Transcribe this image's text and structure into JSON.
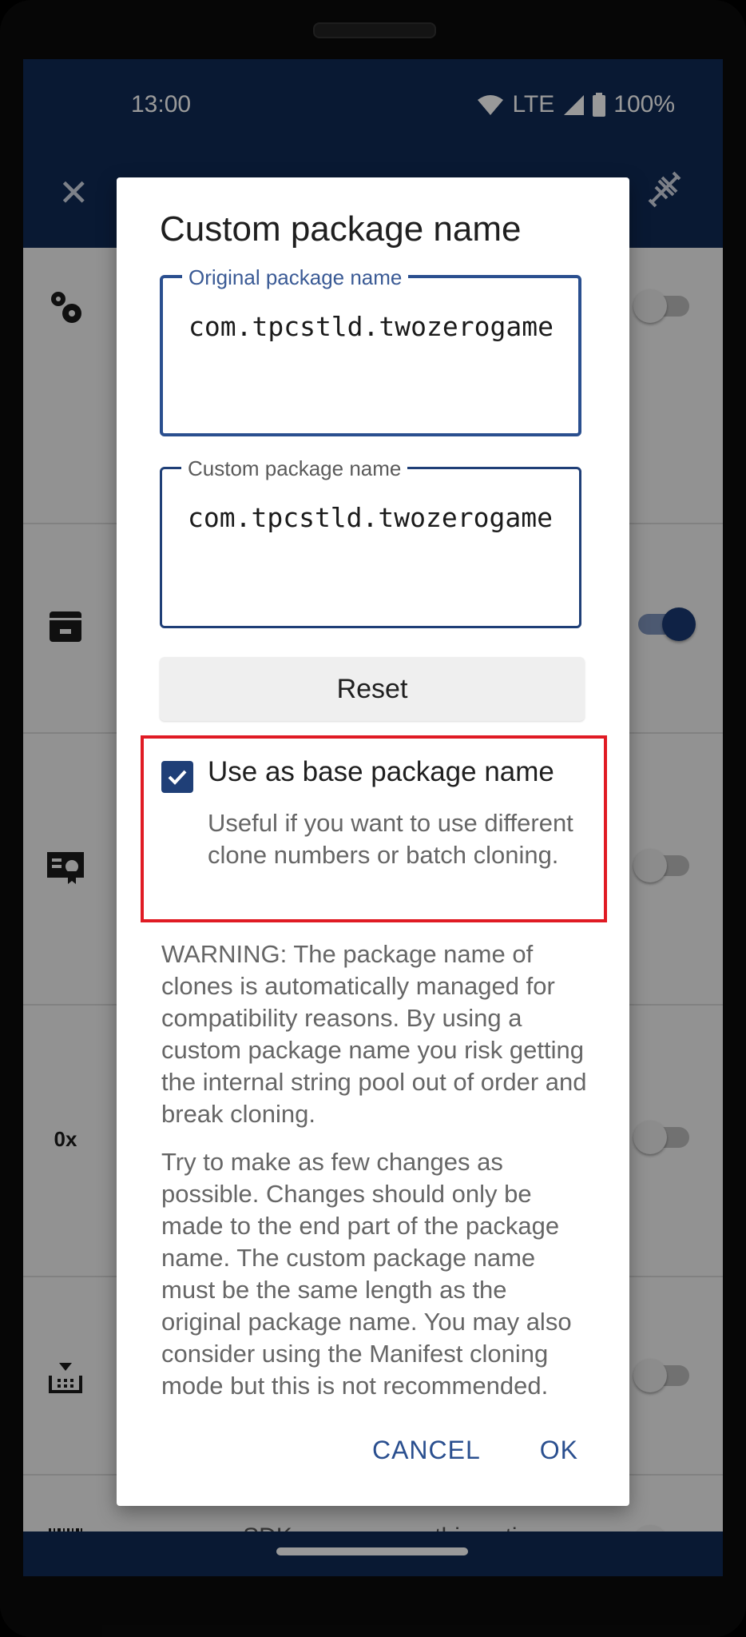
{
  "status_bar": {
    "time": "13:00",
    "network": "LTE",
    "battery": "100%"
  },
  "app_bar": {
    "close_icon": "close-icon",
    "action_icon": "dna-icon"
  },
  "background_list": {
    "rows": [
      {
        "icon": "settings-icon",
        "switch_on": false
      },
      {
        "icon": "storage-icon",
        "switch_on": true
      },
      {
        "icon": "certificate-icon",
        "switch_on": false
      },
      {
        "icon": "hex-icon",
        "icon_text": "0x",
        "switch_on": false
      },
      {
        "icon": "tray-download-icon",
        "switch_on": false
      },
      {
        "icon": "barcode-icon",
        "switch_on": false,
        "text": "scanner SDK you can use this option"
      }
    ]
  },
  "dialog": {
    "title": "Custom package name",
    "original_field": {
      "label": "Original package name",
      "value": "com.tpcstld.twozerogame"
    },
    "custom_field": {
      "label": "Custom package name",
      "value": "com.tpcstld.twozerogame"
    },
    "reset_label": "Reset",
    "base_checkbox": {
      "checked": true,
      "label": "Use as base package name",
      "description": "Useful if you want to use different clone numbers or batch cloning."
    },
    "warning_text": "WARNING: The package name of clones is automatically managed for compatibility reasons. By using a custom package name you risk getting the internal string pool out of order and break cloning.",
    "info_text": "Try to make as few changes as possible. Changes should only be made to the end part of the package name. The custom package name must be the same length as the original package name. You may also consider using the Manifest cloning mode but this is not recommended.",
    "cancel_label": "CANCEL",
    "ok_label": "OK"
  },
  "colors": {
    "primary": "#0f2a55",
    "accent": "#1f3f77",
    "highlight": "#e01b24"
  }
}
